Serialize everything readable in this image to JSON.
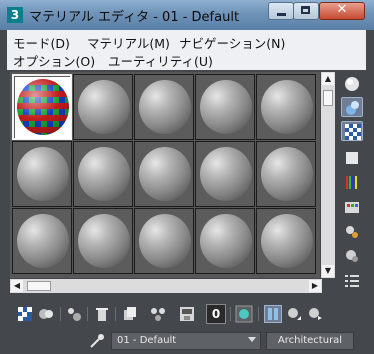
{
  "window": {
    "icon_text": "3",
    "title": "マテリアル エディタ - 01 - Default"
  },
  "menu": [
    {
      "label": "モード(D)"
    },
    {
      "label": "マテリアル(M)"
    },
    {
      "label": "ナビゲーション(N)"
    },
    {
      "label": "オプション(O)"
    },
    {
      "label": "ユーティリティ(U)"
    }
  ],
  "slots": {
    "rows": 3,
    "columns": 5,
    "active_index": 0,
    "active_preview": "checker-pattern-sphere"
  },
  "right_toolbar": [
    "sphere-type-icon",
    "backlight-icon",
    "checker-background-icon",
    "sample-uv-icon",
    "video-color-check-icon",
    "make-preview-icon",
    "options-icon",
    "select-by-material-icon",
    "material-navigator-icon"
  ],
  "bottom_toolbar": [
    "get-material-icon",
    "put-to-scene-icon",
    "assign-to-selection-icon",
    "reset-material-icon",
    "copy-material-icon",
    "make-unique-icon",
    "put-to-library-icon",
    "material-id-channel-icon",
    "show-in-viewport-icon",
    "show-end-result-icon",
    "go-to-parent-icon",
    "go-forward-sibling-icon"
  ],
  "material_id": "0",
  "material_name": "01 - Default",
  "material_type": "Architectural",
  "colors": {
    "active_border": "#f2f2f2",
    "slot_bg": "#5c5c5c",
    "panel_bg": "#44474b",
    "highlight_tool": "#6f7e95"
  }
}
